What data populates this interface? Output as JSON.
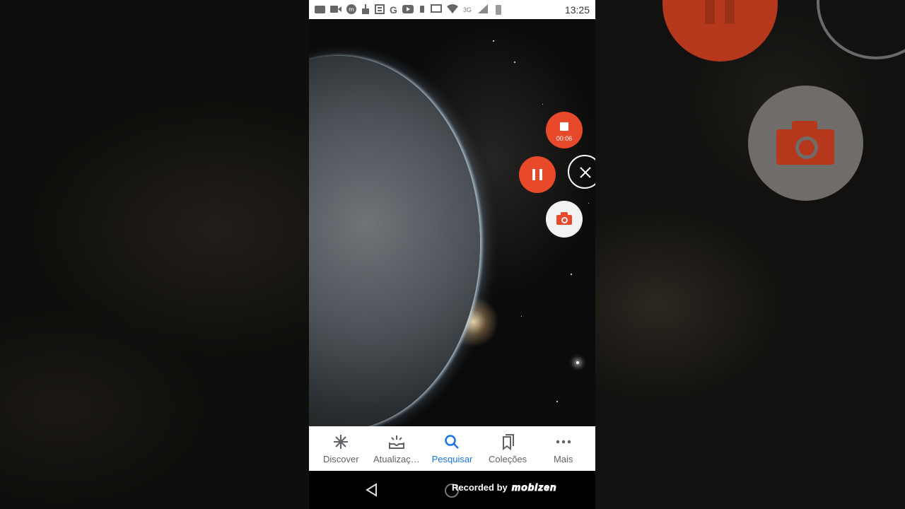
{
  "status_bar": {
    "time": "13:25",
    "network": "3G"
  },
  "recorder": {
    "timer": "00:06"
  },
  "bottom_nav": {
    "items": [
      {
        "label": "Discover",
        "icon": "asterisk-icon"
      },
      {
        "label": "Atualizaç…",
        "icon": "updates-icon"
      },
      {
        "label": "Pesquisar",
        "icon": "search-icon"
      },
      {
        "label": "Coleções",
        "icon": "collections-icon"
      },
      {
        "label": "Mais",
        "icon": "more-dots-icon"
      }
    ],
    "active_index": 2
  },
  "watermark": {
    "text": "Recorded by",
    "brand": "mobizen"
  },
  "colors": {
    "recorder_accent": "#e8492b",
    "active_nav": "#1a73e8"
  }
}
